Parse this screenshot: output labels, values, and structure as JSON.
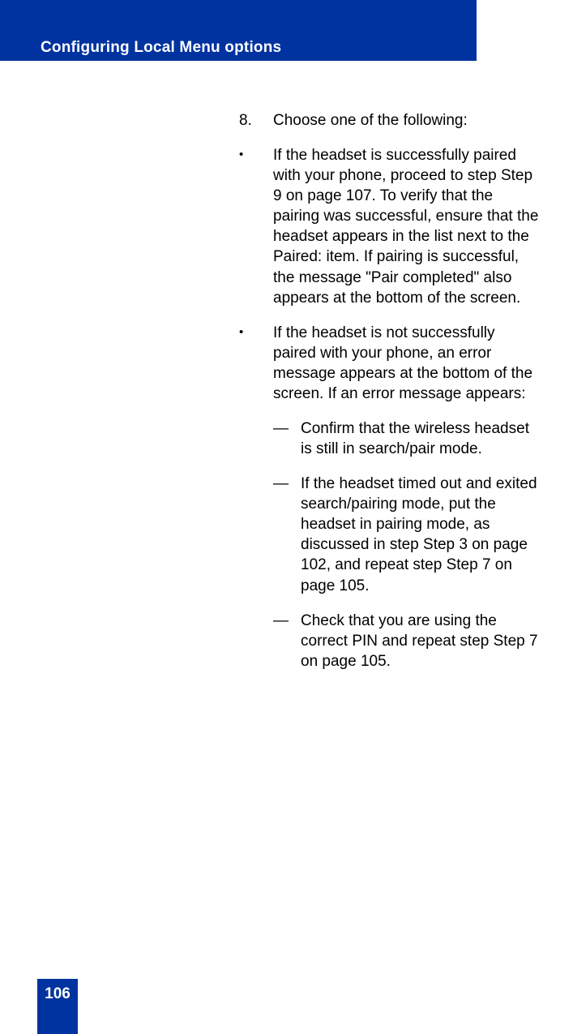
{
  "header": {
    "title": "Configuring Local Menu options"
  },
  "step": {
    "number": "8.",
    "text": "Choose one of the following:"
  },
  "bullets": [
    {
      "marker": "•",
      "text": "If the headset is successfully paired with your phone, proceed to step Step 9 on page 107. To verify that the pairing was successful, ensure that the headset appears in the list next to the Paired: item. If pairing is successful, the message \"Pair completed\" also appears at the bottom of the screen."
    },
    {
      "marker": "•",
      "text": "If the headset is not successfully paired with your phone, an error message appears at the bottom of the screen. If an error message appears:"
    }
  ],
  "dashes": [
    {
      "marker": "—",
      "text": "Confirm that the wireless headset is still in search/pair mode."
    },
    {
      "marker": "—",
      "text": "If the headset timed out and exited search/pairing mode, put the headset in pairing mode, as discussed in step Step 3 on page 102, and repeat step Step 7 on page 105."
    },
    {
      "marker": "—",
      "text": "Check that you are using the correct PIN and repeat step Step 7 on page 105."
    }
  ],
  "footer": {
    "pageNumber": "106"
  }
}
